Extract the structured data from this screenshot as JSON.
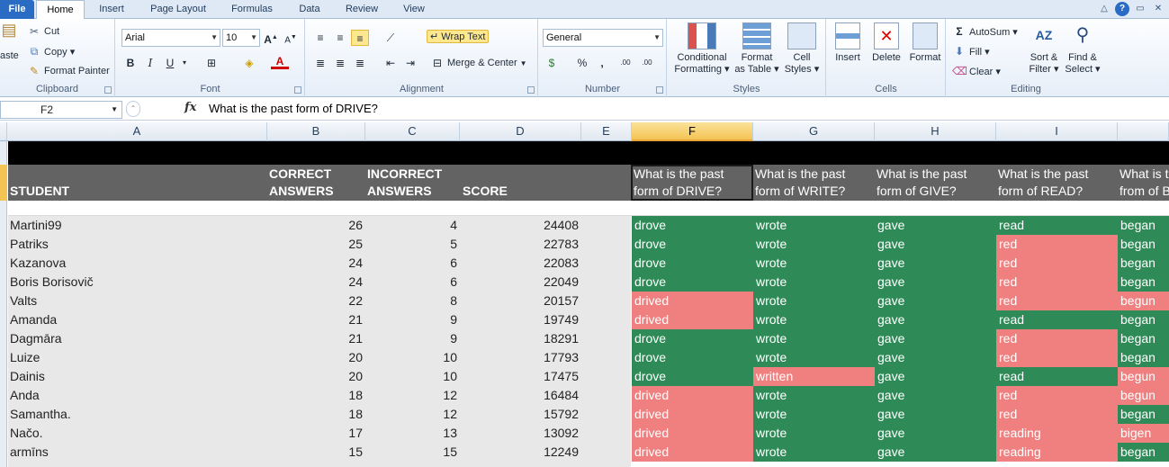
{
  "tabs": [
    "File",
    "Home",
    "Insert",
    "Page Layout",
    "Formulas",
    "Data",
    "Review",
    "View"
  ],
  "clipboard": {
    "paste": "aste",
    "cut": "Cut",
    "copy": "Copy ▾",
    "format_painter": "Format Painter",
    "label": "Clipboard"
  },
  "font": {
    "name": "Arial",
    "size": "10",
    "label": "Font",
    "bold": "B",
    "italic": "I",
    "underline": "U",
    "grow": "A",
    "shrink": "A"
  },
  "alignment": {
    "wrap_text": "Wrap Text",
    "merge_center": "Merge & Center",
    "label": "Alignment"
  },
  "number": {
    "format": "General",
    "currency": "$",
    "percent": "%",
    "comma": ",",
    "inc": ".00",
    "dec": ".00",
    "label": "Number"
  },
  "styles": {
    "conditional": [
      "Conditional",
      "Formatting ▾"
    ],
    "format_table": [
      "Format",
      "as Table ▾"
    ],
    "cell_styles": [
      "Cell",
      "Styles ▾"
    ],
    "label": "Styles"
  },
  "cells": {
    "insert": "Insert",
    "delete": "Delete",
    "format": "Format",
    "label": "Cells"
  },
  "editing": {
    "autosum": "AutoSum ▾",
    "fill": "Fill ▾",
    "clear": "Clear ▾",
    "sort": [
      "Sort &",
      "Filter ▾"
    ],
    "find": [
      "Find &",
      "Select ▾"
    ],
    "label": "Editing"
  },
  "formula_bar": {
    "cell_ref": "F2",
    "fx": "fx",
    "formula": "What is the past form of DRIVE?"
  },
  "columns": [
    "A",
    "B",
    "C",
    "D",
    "E",
    "F",
    "G",
    "H",
    "I"
  ],
  "header": {
    "student": "STUDENT",
    "correct": [
      "CORRECT",
      "ANSWERS"
    ],
    "incorrect": [
      "INCORRECT",
      "ANSWERS"
    ],
    "score": "SCORE",
    "questions": [
      [
        "What is the past",
        "form of DRIVE?"
      ],
      [
        "What is the past",
        "form of WRITE?"
      ],
      [
        "What is the past",
        "form of GIVE?"
      ],
      [
        "What is the past",
        "form of READ?"
      ],
      [
        "What is t",
        "from of B"
      ]
    ]
  },
  "rows": [
    {
      "student": "Martini99",
      "correct": "26",
      "incorrect": "4",
      "score": "24408",
      "answers": [
        "drove",
        "wrote",
        "gave",
        "read",
        "began"
      ],
      "status": [
        "g",
        "g",
        "g",
        "g",
        "g"
      ]
    },
    {
      "student": "Patriks",
      "correct": "25",
      "incorrect": "5",
      "score": "22783",
      "answers": [
        "drove",
        "wrote",
        "gave",
        "red",
        "began"
      ],
      "status": [
        "g",
        "g",
        "g",
        "r",
        "g"
      ]
    },
    {
      "student": "Kazanova",
      "correct": "24",
      "incorrect": "6",
      "score": "22083",
      "answers": [
        "drove",
        "wrote",
        "gave",
        "red",
        "began"
      ],
      "status": [
        "g",
        "g",
        "g",
        "r",
        "g"
      ]
    },
    {
      "student": "Boris Borisovič",
      "correct": "24",
      "incorrect": "6",
      "score": "22049",
      "answers": [
        "drove",
        "wrote",
        "gave",
        "red",
        "began"
      ],
      "status": [
        "g",
        "g",
        "g",
        "r",
        "g"
      ]
    },
    {
      "student": "Valts",
      "correct": "22",
      "incorrect": "8",
      "score": "20157",
      "answers": [
        "drived",
        "wrote",
        "gave",
        "red",
        "begun"
      ],
      "status": [
        "r",
        "g",
        "g",
        "r",
        "r"
      ]
    },
    {
      "student": "Amanda",
      "correct": "21",
      "incorrect": "9",
      "score": "19749",
      "answers": [
        "drived",
        "wrote",
        "gave",
        "read",
        "began"
      ],
      "status": [
        "r",
        "g",
        "g",
        "g",
        "g"
      ]
    },
    {
      "student": "Dagmāra",
      "correct": "21",
      "incorrect": "9",
      "score": "18291",
      "answers": [
        "drove",
        "wrote",
        "gave",
        "red",
        "began"
      ],
      "status": [
        "g",
        "g",
        "g",
        "r",
        "g"
      ]
    },
    {
      "student": "Luize",
      "correct": "20",
      "incorrect": "10",
      "score": "17793",
      "answers": [
        "drove",
        "wrote",
        "gave",
        "red",
        "began"
      ],
      "status": [
        "g",
        "g",
        "g",
        "r",
        "g"
      ]
    },
    {
      "student": "Dainis",
      "correct": "20",
      "incorrect": "10",
      "score": "17475",
      "answers": [
        "drove",
        "written",
        "gave",
        "read",
        "begun"
      ],
      "status": [
        "g",
        "r",
        "g",
        "g",
        "r"
      ]
    },
    {
      "student": "Anda",
      "correct": "18",
      "incorrect": "12",
      "score": "16484",
      "answers": [
        "drived",
        "wrote",
        "gave",
        "red",
        "begun"
      ],
      "status": [
        "r",
        "g",
        "g",
        "r",
        "r"
      ]
    },
    {
      "student": "Samantha.",
      "correct": "18",
      "incorrect": "12",
      "score": "15792",
      "answers": [
        "drived",
        "wrote",
        "gave",
        "red",
        "began"
      ],
      "status": [
        "r",
        "g",
        "g",
        "r",
        "g"
      ]
    },
    {
      "student": "Načo.",
      "correct": "17",
      "incorrect": "13",
      "score": "13092",
      "answers": [
        "drived",
        "wrote",
        "gave",
        "reading",
        "bigen"
      ],
      "status": [
        "r",
        "g",
        "g",
        "r",
        "r"
      ]
    },
    {
      "student": "armīns",
      "correct": "15",
      "incorrect": "15",
      "score": "12249",
      "answers": [
        "drived",
        "wrote",
        "gave",
        "reading",
        "began"
      ],
      "status": [
        "r",
        "g",
        "g",
        "r",
        "g"
      ]
    }
  ],
  "colors": {
    "correct": "#2e8b57",
    "incorrect": "#f08080",
    "header_bg": "#636363",
    "top_band": "#000000",
    "student_bg": "#e8e8e8"
  }
}
